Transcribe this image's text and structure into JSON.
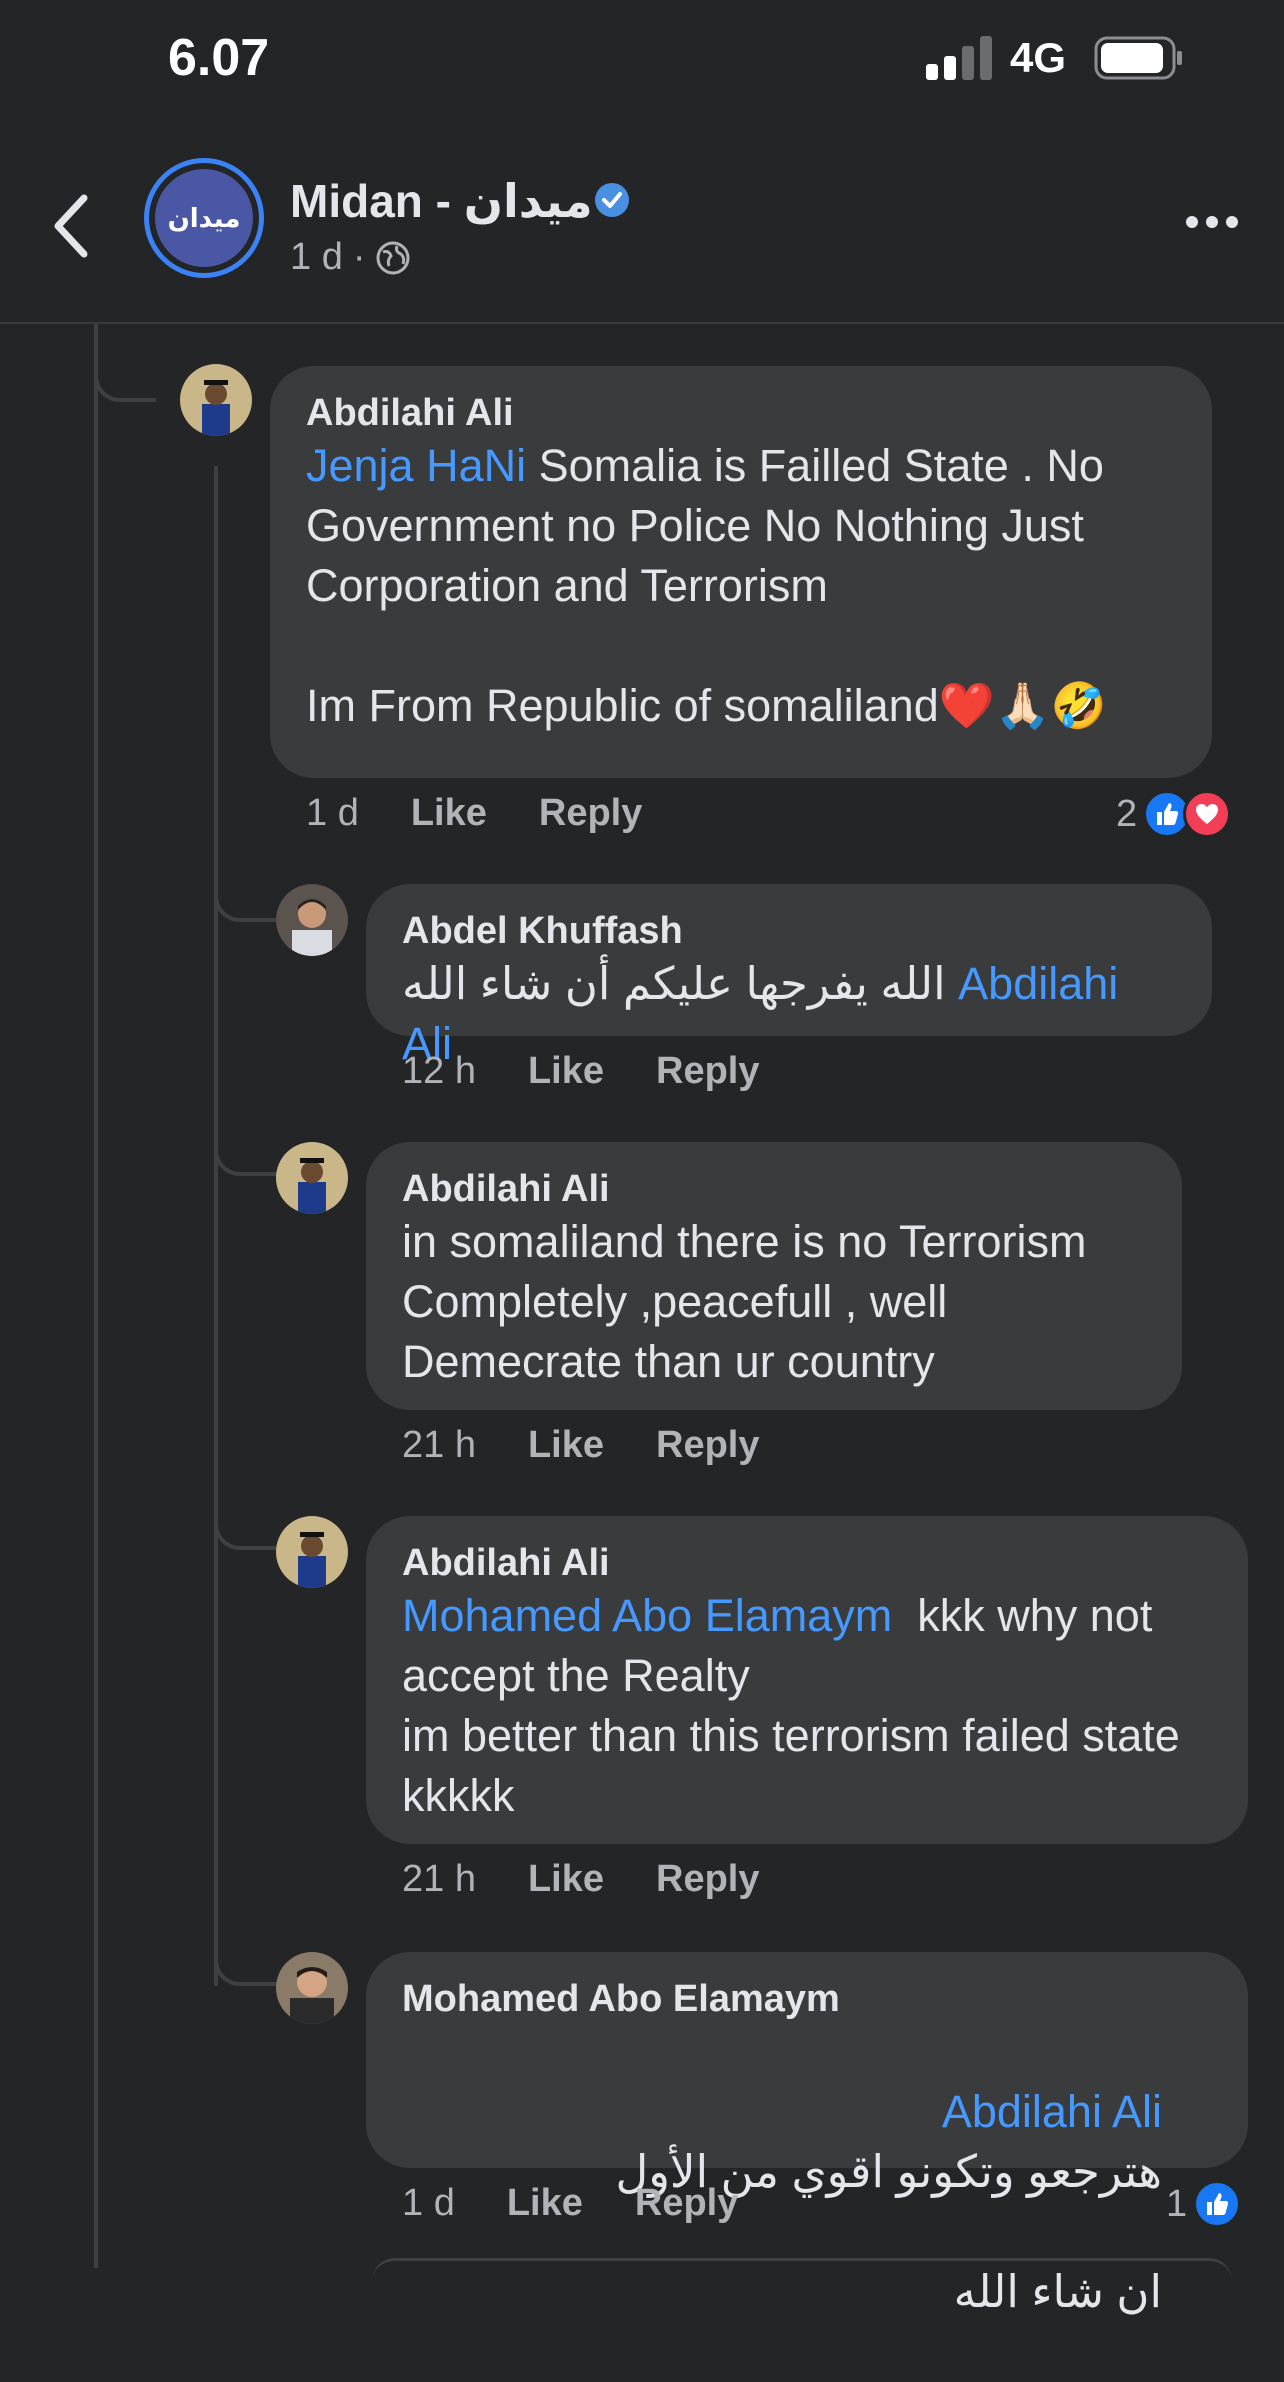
{
  "status": {
    "time": "6.07",
    "network": "4G"
  },
  "header": {
    "page_name": "Midan - ميدان",
    "avatar_text": "ميدان",
    "age": "1 d",
    "separator": "·"
  },
  "comments": [
    {
      "author": "Abdilahi Ali",
      "mention": "Jenja HaNi",
      "text": " Somalia is Failled State . No Government no Police No Nothing Just Corporation and Terrorism\n\nIm From Republic of somaliland❤️🙏🏻🤣",
      "time": "1 d",
      "like": "Like",
      "reply": "Reply",
      "reaction_count": "2"
    },
    {
      "author": "Abdel Khuffash",
      "text": "الله يفرجها عليكم أن شاء الله",
      "mention": "Abdilahi Ali",
      "time": "12 h",
      "like": "Like",
      "reply": "Reply"
    },
    {
      "author": "Abdilahi Ali",
      "text": "in somaliland there is no Terrorism Completely ,peacefull , well Demecrate than ur country",
      "time": "21 h",
      "like": "Like",
      "reply": "Reply"
    },
    {
      "author": "Abdilahi Ali",
      "mention": "Mohamed Abo Elamaym",
      "text": "  kkk why not accept the Realty\nim better than this terrorism failed state kkkkk",
      "time": "21 h",
      "like": "Like",
      "reply": "Reply"
    },
    {
      "author": "Mohamed Abo Elamaym",
      "mention": "Abdilahi Ali",
      "text_line1": "هترجعو وتكونو اقوي من الأول",
      "text_line2": "ان شاء الله",
      "time": "1 d",
      "like": "Like",
      "reply": "Reply",
      "reaction_count": "1"
    }
  ],
  "colors": {
    "background": "#242526",
    "bubble": "#3a3b3c",
    "mention": "#4599ff",
    "like": "#1877f2",
    "love": "#f33e58"
  }
}
